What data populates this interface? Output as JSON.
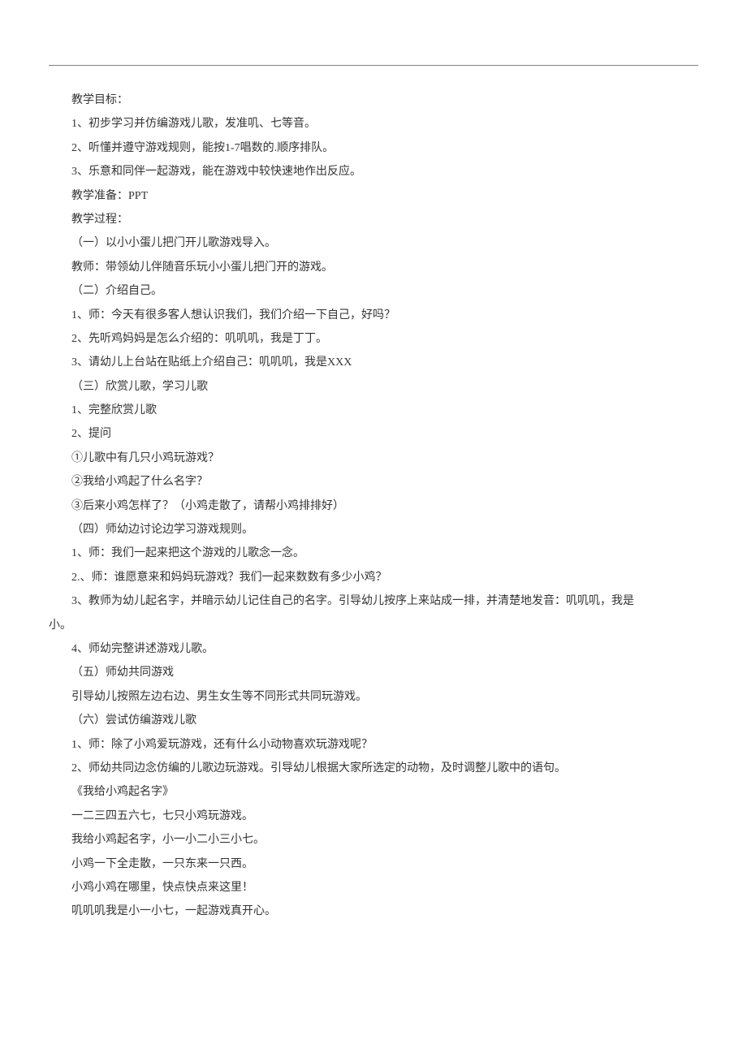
{
  "lines": [
    {
      "text": "教学目标：",
      "indent": true
    },
    {
      "text": "1、初步学习并仿编游戏儿歌，发准叽、七等音。",
      "indent": true
    },
    {
      "text": "2、听懂并遵守游戏规则，能按1-7唱数的.顺序排队。",
      "indent": true
    },
    {
      "text": "3、乐意和同伴一起游戏，能在游戏中较快速地作出反应。",
      "indent": true
    },
    {
      "text": "教学准备：PPT",
      "indent": true
    },
    {
      "text": "教学过程：",
      "indent": true
    },
    {
      "text": "（一）以小小蛋儿把门开儿歌游戏导入。",
      "indent": true
    },
    {
      "text": "教师：带领幼儿伴随音乐玩小小蛋儿把门开的游戏。",
      "indent": true
    },
    {
      "text": "（二）介绍自己。",
      "indent": true
    },
    {
      "text": "1、师：今天有很多客人想认识我们，我们介绍一下自己，好吗？",
      "indent": true
    },
    {
      "text": "2、先听鸡妈妈是怎么介绍的：叽叽叽，我是丁丁。",
      "indent": true
    },
    {
      "text": "3、请幼儿上台站在贴纸上介绍自己：叽叽叽，我是XXX",
      "indent": true
    },
    {
      "text": "（三）欣赏儿歌，学习儿歌",
      "indent": true
    },
    {
      "text": "1、完整欣赏儿歌",
      "indent": true
    },
    {
      "text": "2、提问",
      "indent": true
    },
    {
      "text": "①儿歌中有几只小鸡玩游戏？",
      "indent": true
    },
    {
      "text": "②我给小鸡起了什么名字？",
      "indent": true
    },
    {
      "text": "③后来小鸡怎样了？（小鸡走散了，请帮小鸡排排好）",
      "indent": true
    },
    {
      "text": "（四）师幼边讨论边学习游戏规则。",
      "indent": true
    },
    {
      "text": "1、师：我们一起来把这个游戏的儿歌念一念。",
      "indent": true
    },
    {
      "text": "2.、师：谁愿意来和妈妈玩游戏？我们一起来数数有多少小鸡？",
      "indent": true
    },
    {
      "text": "3、教师为幼儿起名字，并暗示幼儿记住自己的名字。引导幼儿按序上来站成一排，并清楚地发音：叽叽叽，我是",
      "indent": true
    },
    {
      "text": "小。",
      "indent": false
    },
    {
      "text": "4、师幼完整讲述游戏儿歌。",
      "indent": true
    },
    {
      "text": "（五）师幼共同游戏",
      "indent": true
    },
    {
      "text": "引导幼儿按照左边右边、男生女生等不同形式共同玩游戏。",
      "indent": true
    },
    {
      "text": "（六）尝试仿编游戏儿歌",
      "indent": true
    },
    {
      "text": "1、师：除了小鸡爱玩游戏，还有什么小动物喜欢玩游戏呢？",
      "indent": true
    },
    {
      "text": "2、师幼共同边念仿编的儿歌边玩游戏。引导幼儿根据大家所选定的动物，及时调整儿歌中的语句。",
      "indent": true
    },
    {
      "text": "《我给小鸡起名字》",
      "indent": true
    },
    {
      "text": "一二三四五六七，七只小鸡玩游戏。",
      "indent": true
    },
    {
      "text": "我给小鸡起名字，小一小二小三小七。",
      "indent": true
    },
    {
      "text": "小鸡一下全走散，一只东来一只西。",
      "indent": true
    },
    {
      "text": "小鸡小鸡在哪里，快点快点来这里！",
      "indent": true
    },
    {
      "text": "叽叽叽我是小一小七，一起游戏真开心。",
      "indent": true
    }
  ]
}
